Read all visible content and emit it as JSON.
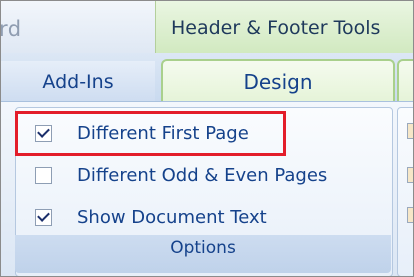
{
  "ribbon": {
    "prev_tab_fragment": "rd",
    "contextual_title": "Header & Footer Tools",
    "tabs": [
      {
        "label": "Add-Ins",
        "selected": false
      },
      {
        "label": "Design",
        "selected": true
      }
    ]
  },
  "options_group": {
    "label": "Options",
    "items": [
      {
        "label": "Different First Page",
        "checked": true,
        "highlighted": true
      },
      {
        "label": "Different Odd & Even Pages",
        "checked": false,
        "highlighted": false
      },
      {
        "label": "Show Document Text",
        "checked": true,
        "highlighted": false
      }
    ]
  },
  "colors": {
    "highlight_border": "#e31d2a",
    "tab_text": "#15428b",
    "contextual_green": "#cfe8bd"
  }
}
